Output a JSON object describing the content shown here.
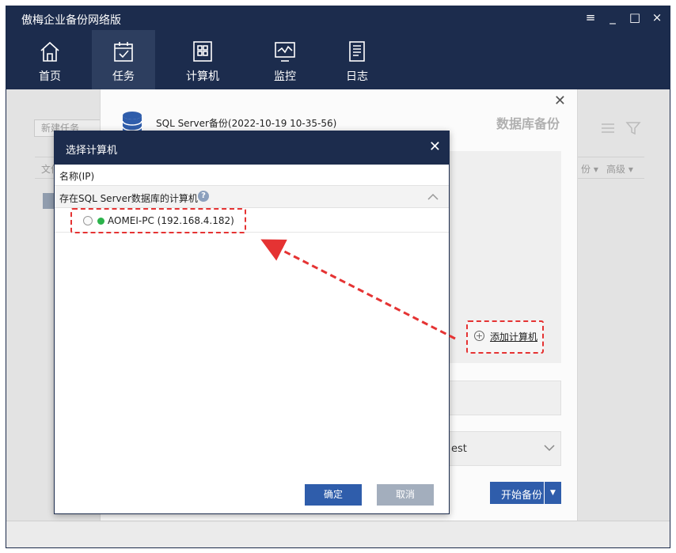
{
  "app": {
    "title": "傲梅企业备份网络版",
    "window_controls": [
      "≡",
      "_",
      "□",
      "×"
    ]
  },
  "nav": [
    {
      "label": "首页",
      "icon": "home-icon"
    },
    {
      "label": "任务",
      "icon": "task-icon",
      "active": true
    },
    {
      "label": "计算机",
      "icon": "computer-icon"
    },
    {
      "label": "监控",
      "icon": "monitor-icon"
    },
    {
      "label": "日志",
      "icon": "log-icon"
    }
  ],
  "background": {
    "new_task_placeholder": "新建任务",
    "col_file": "文件",
    "col_backup": "份 ▾",
    "col_advanced": "高级 ▾"
  },
  "panel": {
    "job_name": "SQL Server备份(2022-10-19 10-35-56)",
    "title": "数据库备份",
    "add_computer": "添加计算机",
    "target_value": "est",
    "start_backup": "开始备份"
  },
  "dialog": {
    "title": "选择计算机",
    "column_name": "名称(IP)",
    "group_label": "存在SQL Server数据库的计算机",
    "computer": "AOMEI-PC (192.168.4.182)",
    "ok": "确定",
    "cancel": "取消"
  },
  "colors": {
    "titlebar": "#1c2c4d",
    "accent": "#2f5dab",
    "highlight": "#e53333",
    "online": "#2bb34b"
  }
}
